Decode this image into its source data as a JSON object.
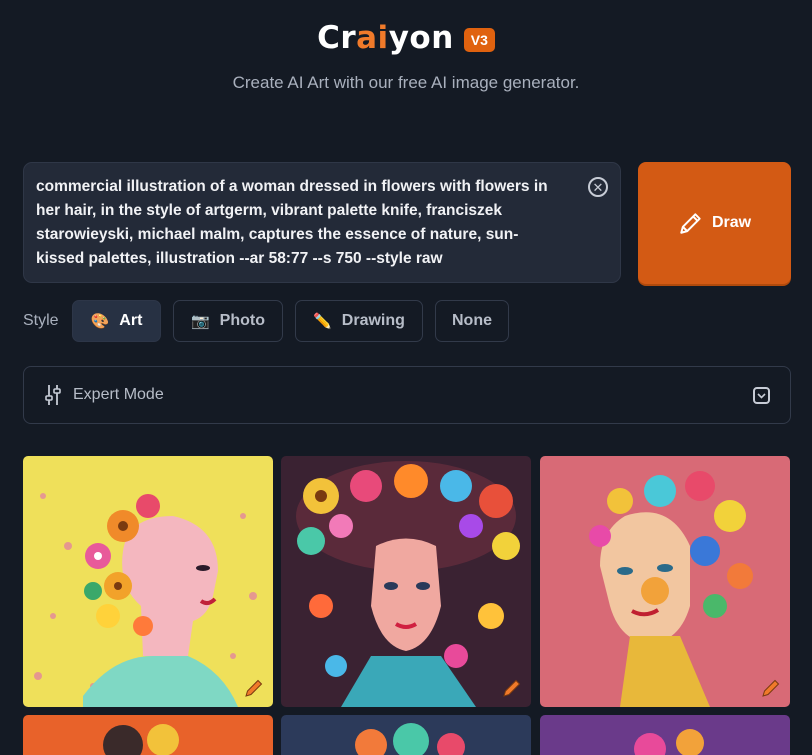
{
  "header": {
    "logo_pre": "Cr",
    "logo_ai": "ai",
    "logo_post": "yon",
    "version": "V3",
    "tagline": "Create AI Art with our free AI image generator."
  },
  "prompt": {
    "text": "commercial illustration of a woman dressed in flowers with flowers in her hair, in the style of artgerm, vibrant palette knife, franciszek starowieyski, michael malm, captures the essence of nature, sun-kissed palettes, illustration --ar 58:77 --s 750 --style raw",
    "clear_icon": "close-circle-icon"
  },
  "draw_button": {
    "label": "Draw",
    "icon": "pencil-icon"
  },
  "style": {
    "label": "Style",
    "options": [
      {
        "label": "Art",
        "icon": "🎨",
        "selected": true
      },
      {
        "label": "Photo",
        "icon": "📷",
        "selected": false
      },
      {
        "label": "Drawing",
        "icon": "✏️",
        "selected": false
      },
      {
        "label": "None",
        "icon": "",
        "selected": false
      }
    ]
  },
  "expert_mode": {
    "label": "Expert Mode",
    "icon": "sliders-icon",
    "toggle_icon": "chevron-down-icon"
  },
  "colors": {
    "accent": "#d35a14",
    "background": "#141a24",
    "panel": "#232a38"
  },
  "images": [
    {
      "name": "woman-flowers-yellow-bg",
      "bg": "#eedb52"
    },
    {
      "name": "woman-flower-crown-dark-bg",
      "bg": "#3a2232"
    },
    {
      "name": "woman-flowers-pink-bg",
      "bg": "#d56b78"
    },
    {
      "name": "partial-image-orange",
      "bg": "#e8622a"
    },
    {
      "name": "partial-image-blue",
      "bg": "#2c3a5a"
    },
    {
      "name": "partial-image-purple",
      "bg": "#6a3a8a"
    }
  ]
}
